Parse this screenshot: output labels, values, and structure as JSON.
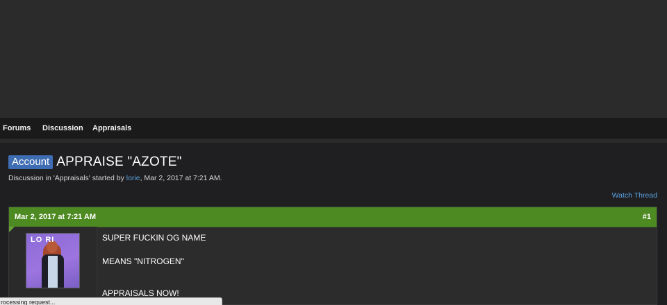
{
  "nav": {
    "items": [
      "Forums",
      "Discussion",
      "Appraisals"
    ]
  },
  "thread": {
    "prefix": "Account",
    "title": "APPRAISE \"AZOTE\"",
    "description_before": "Discussion in 'Appraisals' started by ",
    "author": "lorie",
    "description_after": ", Mar 2, 2017 at 7:21 AM.",
    "watch_label": "Watch Thread"
  },
  "post": {
    "date": "Mar 2, 2017 at 7:21 AM",
    "number": "#1",
    "avatar_text": "LO  RI",
    "lines": [
      "SUPER FUCKIN OG NAME",
      "MEANS \"NITROGEN\"",
      "APPRAISALS NOW!"
    ]
  },
  "status": {
    "text": "rocessing request..."
  },
  "colors": {
    "header_green": "#4e8a22",
    "prefix_blue": "#3f6db3",
    "link_blue": "#5aa0e0",
    "background": "#1f1f21"
  }
}
